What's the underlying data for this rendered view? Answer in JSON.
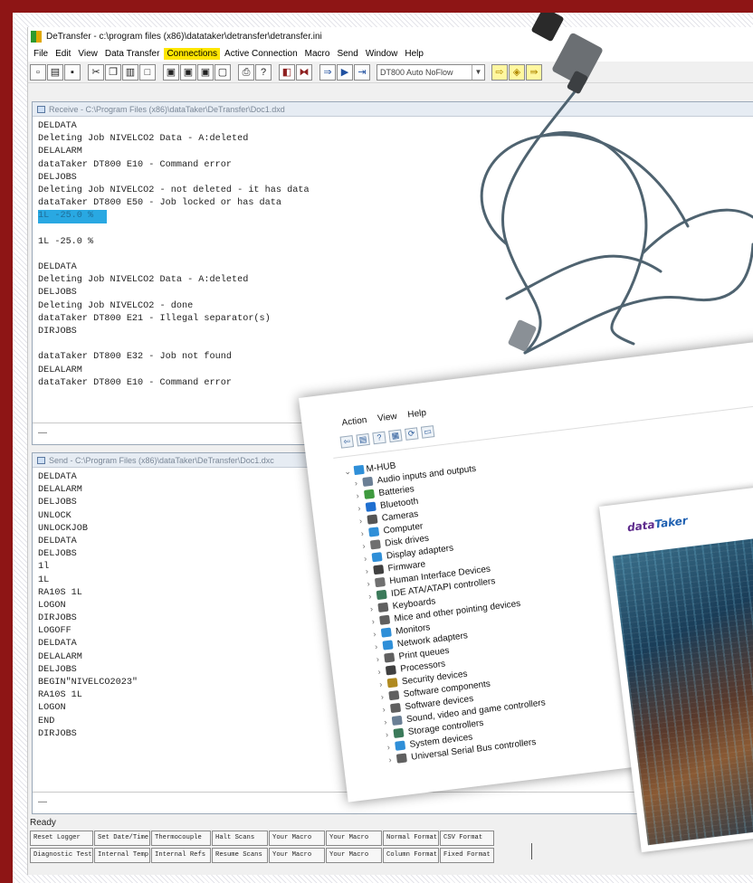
{
  "app": {
    "title": "DeTransfer - c:\\program files (x86)\\datataker\\detransfer\\detransfer.ini",
    "menu": [
      "File",
      "Edit",
      "View",
      "Data Transfer",
      "Connections",
      "Active Connection",
      "Macro",
      "Send",
      "Window",
      "Help"
    ],
    "highlighted_menu": "Connections",
    "port_setting": "DT800 Auto NoFlow",
    "status": "Ready"
  },
  "receive_window": {
    "title": "Receive - C:\\Program Files (x86)\\dataTaker\\DeTransfer\\Doc1.dxd",
    "lines": [
      "DELDATA",
      "Deleting Job NIVELCO2 Data - A:deleted",
      "DELALARM",
      "dataTaker DT800 E10 - Command error",
      "DELJOBS",
      "Deleting Job NIVELCO2 - not deleted - it has data",
      "dataTaker DT800 E50 - Job locked or has data",
      "1L -25.0 %",
      "",
      "1L -25.0 %",
      "",
      "DELDATA",
      "Deleting Job NIVELCO2 Data - A:deleted",
      "DELJOBS",
      "Deleting Job NIVELCO2 - done",
      "dataTaker DT800 E21 - Illegal separator(s)",
      "DIRJOBS",
      "",
      "dataTaker DT800 E32 - Job not found",
      "DELALARM",
      "dataTaker DT800 E10 - Command error"
    ],
    "highlighted_line": 7,
    "footer": "—"
  },
  "send_window": {
    "title": "Send - C:\\Program Files (x86)\\dataTaker\\DeTransfer\\Doc1.dxc",
    "lines": [
      "DELDATA",
      "DELALARM",
      "DELJOBS",
      "UNLOCK",
      "UNLOCKJOB",
      "DELDATA",
      "DELJOBS",
      "1l",
      "1L",
      "RA10S 1L",
      "LOGON",
      "DIRJOBS",
      "LOGOFF",
      "DELDATA",
      "DELALARM",
      "DELJOBS",
      "BEGIN\"NIVELCO2023\"",
      "RA10S 1L",
      "LOGON",
      "END",
      "DIRJOBS"
    ],
    "footer": "—"
  },
  "function_keys": {
    "row1": [
      "Reset Logger",
      "Set Date/Time",
      "Thermocouple",
      "Halt Scans",
      "Your Macro",
      "Your Macro",
      "Normal Format",
      "CSV Format"
    ],
    "row2": [
      "Diagnostic Test",
      "Internal Temp",
      "Internal Refs",
      "Resume Scans",
      "Your Macro",
      "Your Macro",
      "Column Format",
      "Fixed Format"
    ]
  },
  "device_manager": {
    "menu": [
      "Action",
      "View",
      "Help"
    ],
    "root": "M-HUB",
    "categories": [
      {
        "label": "Audio inputs and outputs",
        "icon": "speaker-icon",
        "color": "#6a7f95"
      },
      {
        "label": "Batteries",
        "icon": "battery-icon",
        "color": "#3e9a3e"
      },
      {
        "label": "Bluetooth",
        "icon": "bluetooth-icon",
        "color": "#1f6fd0"
      },
      {
        "label": "Cameras",
        "icon": "camera-icon",
        "color": "#555555"
      },
      {
        "label": "Computer",
        "icon": "computer-icon",
        "color": "#2f8fd8"
      },
      {
        "label": "Disk drives",
        "icon": "disk-icon",
        "color": "#707070"
      },
      {
        "label": "Display adapters",
        "icon": "display-icon",
        "color": "#2f8fd8"
      },
      {
        "label": "Firmware",
        "icon": "chip-icon",
        "color": "#404040"
      },
      {
        "label": "Human Interface Devices",
        "icon": "hid-icon",
        "color": "#707070"
      },
      {
        "label": "IDE ATA/ATAPI controllers",
        "icon": "controller-icon",
        "color": "#3b7a5a"
      },
      {
        "label": "Keyboards",
        "icon": "keyboard-icon",
        "color": "#606060"
      },
      {
        "label": "Mice and other pointing devices",
        "icon": "mouse-icon",
        "color": "#606060"
      },
      {
        "label": "Monitors",
        "icon": "monitor-icon",
        "color": "#2f8fd8"
      },
      {
        "label": "Network adapters",
        "icon": "network-icon",
        "color": "#2f8fd8"
      },
      {
        "label": "Print queues",
        "icon": "printer-icon",
        "color": "#606060"
      },
      {
        "label": "Processors",
        "icon": "processor-icon",
        "color": "#404040"
      },
      {
        "label": "Security devices",
        "icon": "security-icon",
        "color": "#b08a20"
      },
      {
        "label": "Software components",
        "icon": "component-icon",
        "color": "#606060"
      },
      {
        "label": "Software devices",
        "icon": "device-icon",
        "color": "#606060"
      },
      {
        "label": "Sound, video and game controllers",
        "icon": "sound-icon",
        "color": "#6a7f95"
      },
      {
        "label": "Storage controllers",
        "icon": "storage-icon",
        "color": "#3b7a5a"
      },
      {
        "label": "System devices",
        "icon": "system-icon",
        "color": "#2f8fd8"
      },
      {
        "label": "Universal Serial Bus controllers",
        "icon": "usb-icon",
        "color": "#606060"
      }
    ]
  },
  "brochure": {
    "brand_prefix": "data",
    "brand_suffix": "Taker"
  }
}
